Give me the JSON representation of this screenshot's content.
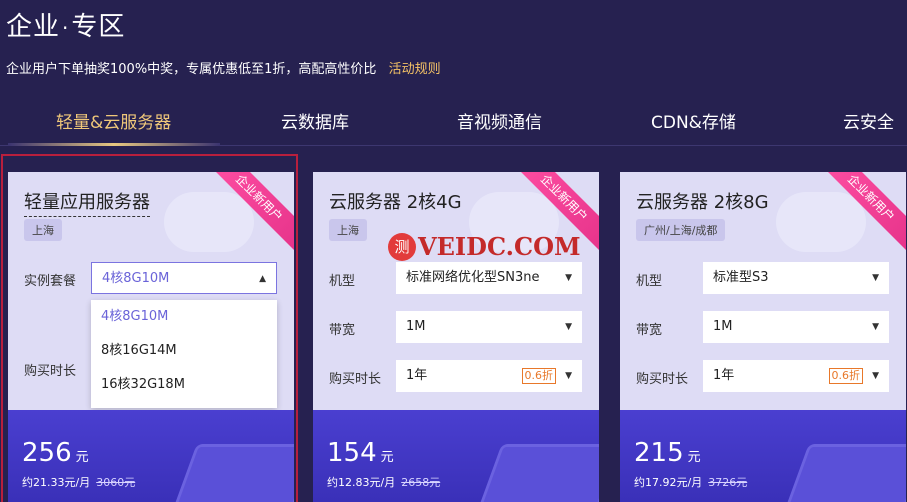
{
  "header": {
    "title_left": "企业",
    "title_dot": "·",
    "title_right": "专区",
    "subtitle": "企业用户下单抽奖100%中奖，专属优惠低至1折，高配高性价比",
    "rules_link": "活动规则"
  },
  "tabs": [
    {
      "label": "轻量&云服务器",
      "active": true
    },
    {
      "label": "云数据库",
      "active": false
    },
    {
      "label": "音视频通信",
      "active": false
    },
    {
      "label": "CDN&存储",
      "active": false
    },
    {
      "label": "云安全",
      "active": false
    }
  ],
  "ribbon_label": "企业新用户",
  "cards": [
    {
      "title": "轻量应用服务器",
      "region": "上海",
      "rows": [
        {
          "label": "实例套餐",
          "value": "4核8G10M"
        },
        {
          "label": "购买时长",
          "value": ""
        }
      ],
      "dropdown_options": [
        "4核8G10M",
        "8核16G14M",
        "16核32G18M"
      ],
      "price": "256",
      "price_unit": "元",
      "monthly": "约21.33元/月",
      "original": "3060元"
    },
    {
      "title": "云服务器 2核4G",
      "region": "上海",
      "rows": [
        {
          "label": "机型",
          "value": "标准网络优化型SN3ne"
        },
        {
          "label": "带宽",
          "value": "1M"
        },
        {
          "label": "购买时长",
          "value": "1年",
          "discount": "0.6折"
        }
      ],
      "price": "154",
      "price_unit": "元",
      "monthly": "约12.83元/月",
      "original": "2658元"
    },
    {
      "title": "云服务器 2核8G",
      "region": "广州/上海/成都",
      "rows": [
        {
          "label": "机型",
          "value": "标准型S3"
        },
        {
          "label": "带宽",
          "value": "1M"
        },
        {
          "label": "购买时长",
          "value": "1年",
          "discount": "0.6折"
        }
      ],
      "price": "215",
      "price_unit": "元",
      "monthly": "约17.92元/月",
      "original": "3726元"
    }
  ],
  "watermark": {
    "badge": "测",
    "text": "VEIDC.COM"
  },
  "colors": {
    "background": "#262150",
    "accent_gold": "#f0c87a",
    "price_area": "#4a3fd0",
    "discount": "#e8782a",
    "ribbon": "#ff4fa3"
  }
}
